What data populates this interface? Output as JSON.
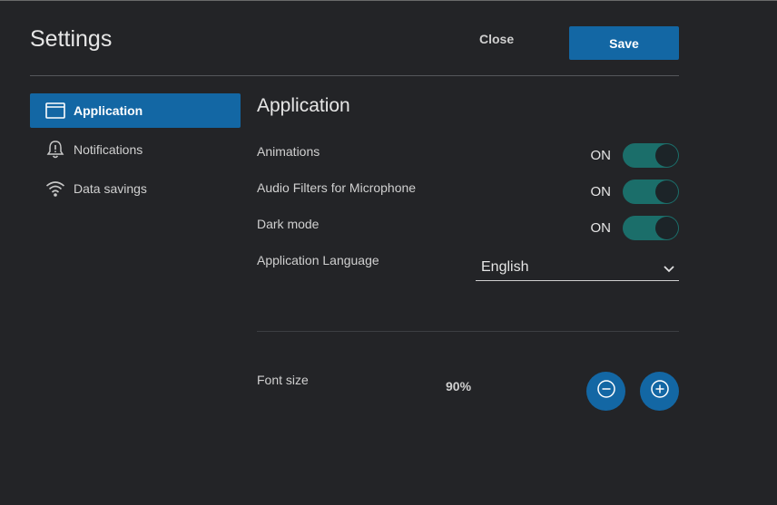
{
  "header": {
    "title": "Settings",
    "close_label": "Close",
    "save_label": "Save"
  },
  "sidebar": {
    "items": [
      {
        "label": "Application",
        "icon": "window-icon",
        "active": true
      },
      {
        "label": "Notifications",
        "icon": "bell-alert-icon",
        "active": false
      },
      {
        "label": "Data savings",
        "icon": "wifi-icon",
        "active": false
      }
    ]
  },
  "main": {
    "section_title": "Application",
    "toggles": [
      {
        "label": "Animations",
        "state": "ON"
      },
      {
        "label": "Audio Filters for Microphone",
        "state": "ON"
      },
      {
        "label": "Dark mode",
        "state": "ON"
      }
    ],
    "language": {
      "label": "Application Language",
      "value": "English"
    },
    "font_size": {
      "label": "Font size",
      "value": "90%"
    }
  },
  "colors": {
    "background": "#232427",
    "accent": "#1367a4",
    "toggle_on": "#1b6e6a"
  }
}
